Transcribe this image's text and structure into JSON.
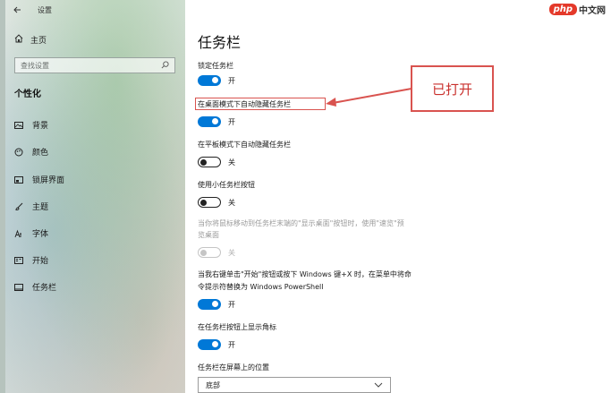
{
  "titlebar": {
    "title": "设置"
  },
  "sidebar": {
    "home_label": "主页",
    "search_placeholder": "查找设置",
    "section_title": "个性化",
    "items": [
      {
        "label": "背景",
        "icon": "picture-icon"
      },
      {
        "label": "颜色",
        "icon": "palette-icon"
      },
      {
        "label": "锁屏界面",
        "icon": "lock-screen-icon"
      },
      {
        "label": "主题",
        "icon": "brush-icon"
      },
      {
        "label": "字体",
        "icon": "font-icon"
      },
      {
        "label": "开始",
        "icon": "start-icon"
      },
      {
        "label": "任务栏",
        "icon": "taskbar-icon",
        "active": true
      }
    ]
  },
  "main": {
    "title": "任务栏",
    "settings": [
      {
        "label": "锁定任务栏",
        "state": "开",
        "on": true
      },
      {
        "label": "在桌面模式下自动隐藏任务栏",
        "state": "开",
        "on": true
      },
      {
        "label": "在平板模式下自动隐藏任务栏",
        "state": "关",
        "on": false
      },
      {
        "label": "使用小任务栏按钮",
        "state": "关",
        "on": false
      },
      {
        "label_line1": "当你将鼠标移动到任务栏末端的\"显示桌面\"按钮时，使用\"速览\"预",
        "label_line2": "览桌面",
        "state": "关",
        "on": false,
        "disabled": true
      },
      {
        "label_line1": "当我右键单击\"开始\"按钮或按下 Windows 键+X 时，在菜单中将命",
        "label_line2": "令提示符替换为 Windows PowerShell",
        "state": "开",
        "on": true
      },
      {
        "label": "在任务栏按钮上显示角标",
        "state": "开",
        "on": true
      }
    ],
    "position_label": "任务栏在屏幕上的位置",
    "position_value": "底部"
  },
  "annotation": {
    "callout_text": "已打开",
    "color": "#d9534f"
  },
  "watermark": {
    "brand": "php",
    "site": "中文网"
  },
  "colors": {
    "accent": "#0078d7"
  }
}
